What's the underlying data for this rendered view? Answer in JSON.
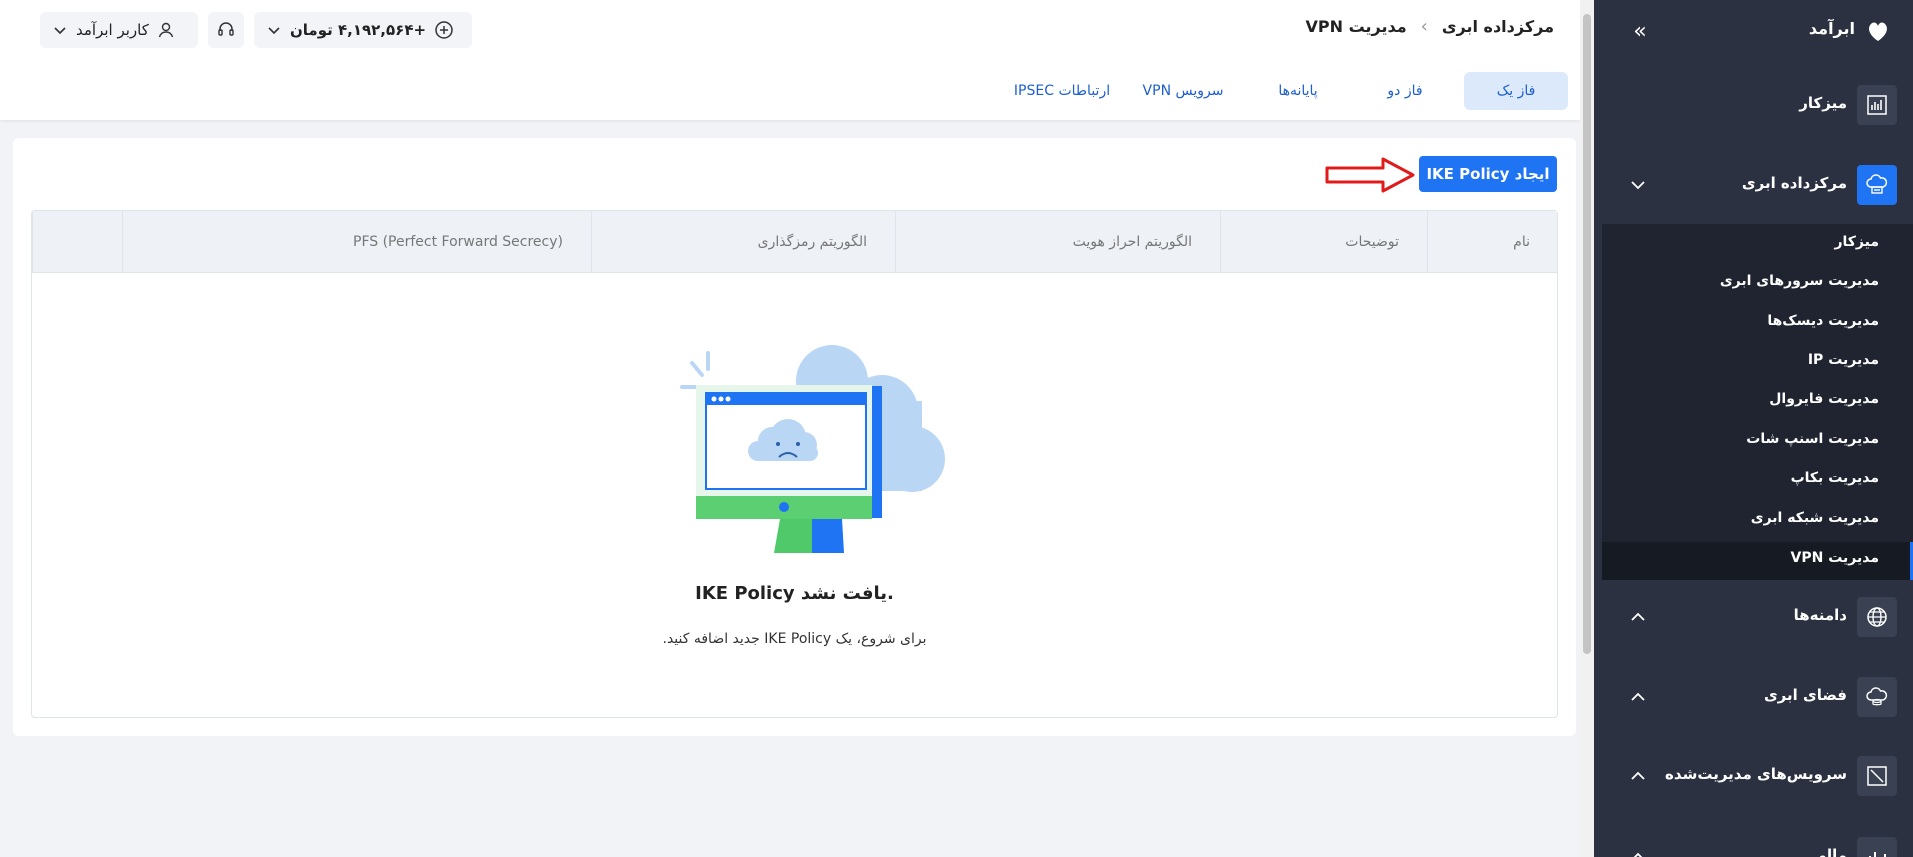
{
  "sidebar": {
    "brand": "ابرآمد",
    "items": [
      {
        "label": "میزکار",
        "icon": "dashboard-chart-icon"
      },
      {
        "label": "مرکزداده ابری",
        "icon": "cloud-datacenter-icon"
      },
      {
        "label": "دامنه‌ها",
        "icon": "globe-icon"
      },
      {
        "label": "فضای ابری",
        "icon": "cloud-storage-icon"
      },
      {
        "label": "سرویس‌های مدیریت‌شده",
        "icon": "managed-services-icon"
      },
      {
        "label": "مالی",
        "icon": "finance-chart-icon"
      }
    ],
    "sub_items": [
      {
        "label": "میزکار"
      },
      {
        "label": "مدیریت سرورهای ابری"
      },
      {
        "label": "مدیریت دیسک‌ها"
      },
      {
        "label": "مدیریت IP"
      },
      {
        "label": "مدیریت فایروال"
      },
      {
        "label": "مدیریت اسنپ شات"
      },
      {
        "label": "مدیریت بکاپ"
      },
      {
        "label": "مدیریت شبکه ابری"
      },
      {
        "label": "مدیریت VPN"
      }
    ]
  },
  "header": {
    "breadcrumb": [
      "مرکزداده ابری",
      "مدیریت VPN"
    ],
    "balance": "+۴,۱۹۲,۵۶۴ تومان",
    "user": "کاربر ابرآمد",
    "tabs": [
      {
        "label": "فاز یک",
        "active": true
      },
      {
        "label": "فاز دو"
      },
      {
        "label": "پایانه‌ها"
      },
      {
        "label": "سرویس VPN"
      },
      {
        "label": "ارتباطات IPSEC"
      }
    ]
  },
  "main": {
    "create_button": "ایجاد IKE Policy",
    "columns": [
      "نام",
      "توضیحات",
      "الگوریتم احراز هویت",
      "الگوریتم رمزگذاری",
      "PFS (Perfect Forward Secrecy)",
      ""
    ],
    "empty_title": "IKE Policy یافت نشد.",
    "empty_subtitle": "برای شروع، یک IKE Policy جدید اضافه کنید."
  },
  "colors": {
    "accent": "#1e74f2",
    "sidebar_bg": "#2b3140",
    "arrow": "#e01b1b"
  }
}
